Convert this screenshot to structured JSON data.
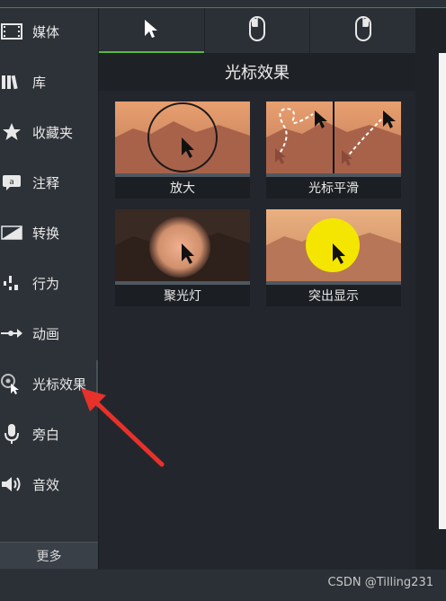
{
  "sidebar": {
    "items": [
      {
        "label": "媒体",
        "icon": "film-strip-icon"
      },
      {
        "label": "库",
        "icon": "library-books-icon"
      },
      {
        "label": "收藏夹",
        "icon": "star-icon"
      },
      {
        "label": "注释",
        "icon": "annotation-bubble-icon"
      },
      {
        "label": "转换",
        "icon": "transition-icon"
      },
      {
        "label": "行为",
        "icon": "behavior-icon"
      },
      {
        "label": "动画",
        "icon": "animation-arrow-icon"
      },
      {
        "label": "光标效果",
        "icon": "cursor-effect-icon"
      },
      {
        "label": "旁白",
        "icon": "microphone-icon"
      },
      {
        "label": "音效",
        "icon": "speaker-icon"
      }
    ],
    "active_index": 7,
    "more_label": "更多"
  },
  "tabs": [
    {
      "name": "cursor-tab",
      "icon": "cursor-arrow-icon"
    },
    {
      "name": "left-click-tab",
      "icon": "mouse-left-click-icon"
    },
    {
      "name": "right-click-tab",
      "icon": "mouse-right-click-icon"
    }
  ],
  "section_title": "光标效果",
  "effects": [
    {
      "label": "放大"
    },
    {
      "label": "光标平滑"
    },
    {
      "label": "聚光灯"
    },
    {
      "label": "突出显示"
    }
  ],
  "watermark": "CSDN @Tilling231",
  "colors": {
    "accent_green": "#5ab83a",
    "annotation_red": "#e8312a",
    "highlight_yellow": "#f4e600"
  }
}
